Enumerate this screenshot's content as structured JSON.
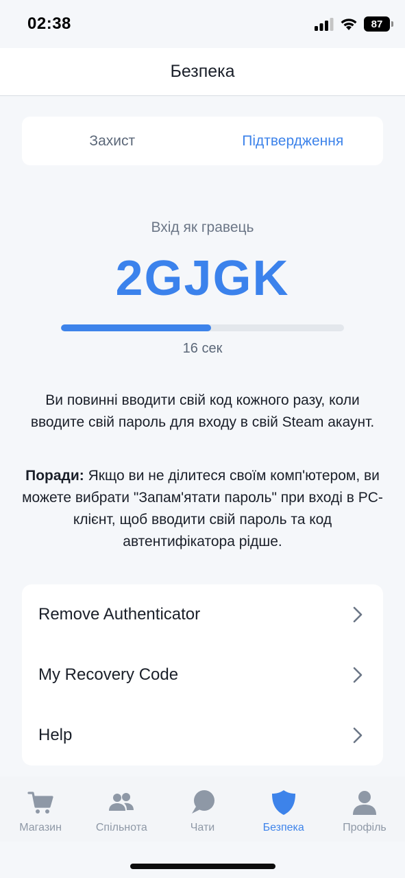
{
  "status_bar": {
    "time": "02:38",
    "battery": "87",
    "icons": [
      "signal-icon",
      "wifi-icon",
      "battery-icon"
    ]
  },
  "header": {
    "title": "Безпека"
  },
  "tabs": [
    {
      "label": "Захист",
      "active": false
    },
    {
      "label": "Підтвердження",
      "active": true
    }
  ],
  "code_section": {
    "login_label": "Вхід як гравець",
    "code": "2GJGK",
    "progress": 0.53,
    "timer": "16 сек"
  },
  "description": "Ви повинні вводити свій код кожного разу, коли вводите свій пароль для входу в свій Steam акаунт.",
  "tips": {
    "label": "Поради:",
    "text": " Якщо ви не ділитеся своїм комп'ютером, ви можете вибрати \"Запам'ятати пароль\" при вході в PC-клієнт, щоб вводити свій пароль та код автентифікатора рідше."
  },
  "menu": [
    {
      "label": "Remove Authenticator",
      "icon": "chevron-right-icon"
    },
    {
      "label": "My Recovery Code",
      "icon": "chevron-right-icon"
    },
    {
      "label": "Help",
      "icon": "chevron-right-icon"
    }
  ],
  "tab_bar": [
    {
      "label": "Магазин",
      "icon": "cart-icon",
      "active": false
    },
    {
      "label": "Спільнота",
      "icon": "community-icon",
      "active": false
    },
    {
      "label": "Чати",
      "icon": "chat-icon",
      "active": false
    },
    {
      "label": "Безпека",
      "icon": "shield-icon",
      "active": true
    },
    {
      "label": "Профіль",
      "icon": "profile-icon",
      "active": false
    }
  ],
  "colors": {
    "accent": "#3d83ea",
    "inactive": "#8e98a6",
    "background": "#f5f7fa"
  }
}
